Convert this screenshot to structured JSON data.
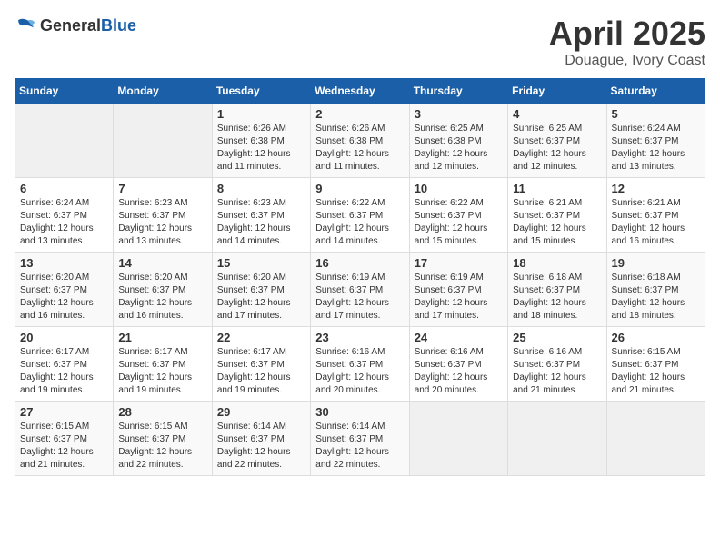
{
  "logo": {
    "general": "General",
    "blue": "Blue"
  },
  "header": {
    "month": "April 2025",
    "location": "Douague, Ivory Coast"
  },
  "weekdays": [
    "Sunday",
    "Monday",
    "Tuesday",
    "Wednesday",
    "Thursday",
    "Friday",
    "Saturday"
  ],
  "weeks": [
    [
      {
        "day": "",
        "empty": true
      },
      {
        "day": "",
        "empty": true
      },
      {
        "day": "1",
        "sunrise": "Sunrise: 6:26 AM",
        "sunset": "Sunset: 6:38 PM",
        "daylight": "Daylight: 12 hours and 11 minutes."
      },
      {
        "day": "2",
        "sunrise": "Sunrise: 6:26 AM",
        "sunset": "Sunset: 6:38 PM",
        "daylight": "Daylight: 12 hours and 11 minutes."
      },
      {
        "day": "3",
        "sunrise": "Sunrise: 6:25 AM",
        "sunset": "Sunset: 6:38 PM",
        "daylight": "Daylight: 12 hours and 12 minutes."
      },
      {
        "day": "4",
        "sunrise": "Sunrise: 6:25 AM",
        "sunset": "Sunset: 6:37 PM",
        "daylight": "Daylight: 12 hours and 12 minutes."
      },
      {
        "day": "5",
        "sunrise": "Sunrise: 6:24 AM",
        "sunset": "Sunset: 6:37 PM",
        "daylight": "Daylight: 12 hours and 13 minutes."
      }
    ],
    [
      {
        "day": "6",
        "sunrise": "Sunrise: 6:24 AM",
        "sunset": "Sunset: 6:37 PM",
        "daylight": "Daylight: 12 hours and 13 minutes."
      },
      {
        "day": "7",
        "sunrise": "Sunrise: 6:23 AM",
        "sunset": "Sunset: 6:37 PM",
        "daylight": "Daylight: 12 hours and 13 minutes."
      },
      {
        "day": "8",
        "sunrise": "Sunrise: 6:23 AM",
        "sunset": "Sunset: 6:37 PM",
        "daylight": "Daylight: 12 hours and 14 minutes."
      },
      {
        "day": "9",
        "sunrise": "Sunrise: 6:22 AM",
        "sunset": "Sunset: 6:37 PM",
        "daylight": "Daylight: 12 hours and 14 minutes."
      },
      {
        "day": "10",
        "sunrise": "Sunrise: 6:22 AM",
        "sunset": "Sunset: 6:37 PM",
        "daylight": "Daylight: 12 hours and 15 minutes."
      },
      {
        "day": "11",
        "sunrise": "Sunrise: 6:21 AM",
        "sunset": "Sunset: 6:37 PM",
        "daylight": "Daylight: 12 hours and 15 minutes."
      },
      {
        "day": "12",
        "sunrise": "Sunrise: 6:21 AM",
        "sunset": "Sunset: 6:37 PM",
        "daylight": "Daylight: 12 hours and 16 minutes."
      }
    ],
    [
      {
        "day": "13",
        "sunrise": "Sunrise: 6:20 AM",
        "sunset": "Sunset: 6:37 PM",
        "daylight": "Daylight: 12 hours and 16 minutes."
      },
      {
        "day": "14",
        "sunrise": "Sunrise: 6:20 AM",
        "sunset": "Sunset: 6:37 PM",
        "daylight": "Daylight: 12 hours and 16 minutes."
      },
      {
        "day": "15",
        "sunrise": "Sunrise: 6:20 AM",
        "sunset": "Sunset: 6:37 PM",
        "daylight": "Daylight: 12 hours and 17 minutes."
      },
      {
        "day": "16",
        "sunrise": "Sunrise: 6:19 AM",
        "sunset": "Sunset: 6:37 PM",
        "daylight": "Daylight: 12 hours and 17 minutes."
      },
      {
        "day": "17",
        "sunrise": "Sunrise: 6:19 AM",
        "sunset": "Sunset: 6:37 PM",
        "daylight": "Daylight: 12 hours and 17 minutes."
      },
      {
        "day": "18",
        "sunrise": "Sunrise: 6:18 AM",
        "sunset": "Sunset: 6:37 PM",
        "daylight": "Daylight: 12 hours and 18 minutes."
      },
      {
        "day": "19",
        "sunrise": "Sunrise: 6:18 AM",
        "sunset": "Sunset: 6:37 PM",
        "daylight": "Daylight: 12 hours and 18 minutes."
      }
    ],
    [
      {
        "day": "20",
        "sunrise": "Sunrise: 6:17 AM",
        "sunset": "Sunset: 6:37 PM",
        "daylight": "Daylight: 12 hours and 19 minutes."
      },
      {
        "day": "21",
        "sunrise": "Sunrise: 6:17 AM",
        "sunset": "Sunset: 6:37 PM",
        "daylight": "Daylight: 12 hours and 19 minutes."
      },
      {
        "day": "22",
        "sunrise": "Sunrise: 6:17 AM",
        "sunset": "Sunset: 6:37 PM",
        "daylight": "Daylight: 12 hours and 19 minutes."
      },
      {
        "day": "23",
        "sunrise": "Sunrise: 6:16 AM",
        "sunset": "Sunset: 6:37 PM",
        "daylight": "Daylight: 12 hours and 20 minutes."
      },
      {
        "day": "24",
        "sunrise": "Sunrise: 6:16 AM",
        "sunset": "Sunset: 6:37 PM",
        "daylight": "Daylight: 12 hours and 20 minutes."
      },
      {
        "day": "25",
        "sunrise": "Sunrise: 6:16 AM",
        "sunset": "Sunset: 6:37 PM",
        "daylight": "Daylight: 12 hours and 21 minutes."
      },
      {
        "day": "26",
        "sunrise": "Sunrise: 6:15 AM",
        "sunset": "Sunset: 6:37 PM",
        "daylight": "Daylight: 12 hours and 21 minutes."
      }
    ],
    [
      {
        "day": "27",
        "sunrise": "Sunrise: 6:15 AM",
        "sunset": "Sunset: 6:37 PM",
        "daylight": "Daylight: 12 hours and 21 minutes."
      },
      {
        "day": "28",
        "sunrise": "Sunrise: 6:15 AM",
        "sunset": "Sunset: 6:37 PM",
        "daylight": "Daylight: 12 hours and 22 minutes."
      },
      {
        "day": "29",
        "sunrise": "Sunrise: 6:14 AM",
        "sunset": "Sunset: 6:37 PM",
        "daylight": "Daylight: 12 hours and 22 minutes."
      },
      {
        "day": "30",
        "sunrise": "Sunrise: 6:14 AM",
        "sunset": "Sunset: 6:37 PM",
        "daylight": "Daylight: 12 hours and 22 minutes."
      },
      {
        "day": "",
        "empty": true
      },
      {
        "day": "",
        "empty": true
      },
      {
        "day": "",
        "empty": true
      }
    ]
  ]
}
